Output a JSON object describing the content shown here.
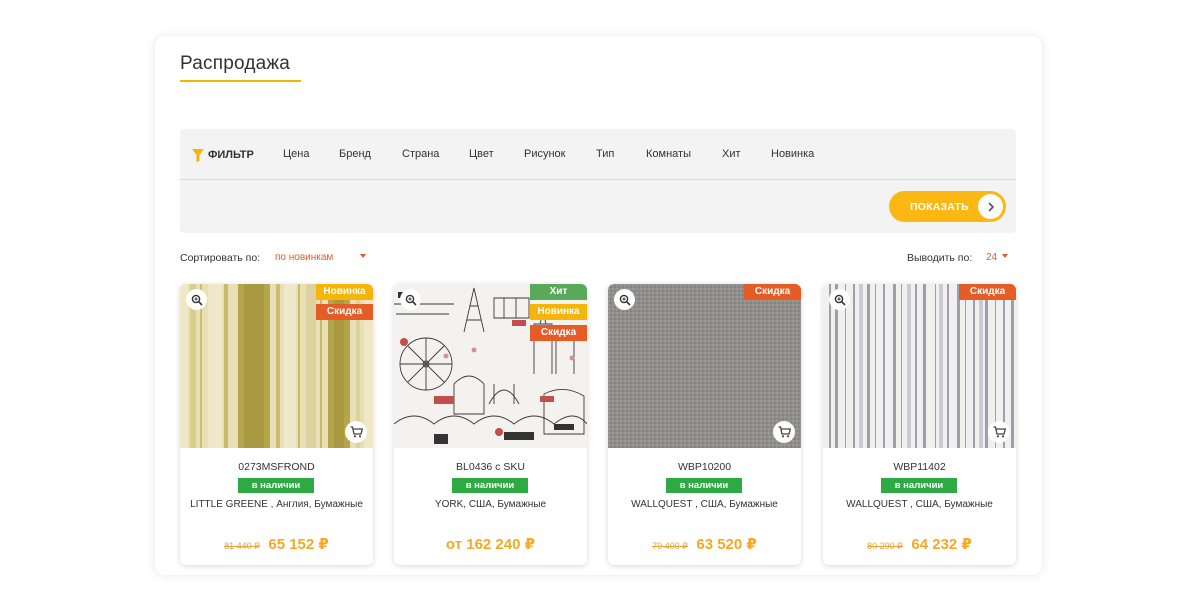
{
  "section": {
    "title": "Распродажа"
  },
  "filter": {
    "head_label": "ФИЛЬТР",
    "items": [
      "Цена",
      "Бренд",
      "Страна",
      "Цвет",
      "Рисунок",
      "Тип",
      "Комнаты",
      "Хит",
      "Новинка"
    ],
    "show_button": "ПОКАЗАТЬ"
  },
  "sort": {
    "label": "Сортировать по:",
    "value": "по новинкам"
  },
  "per_page": {
    "label": "Выводить по:",
    "value": "24"
  },
  "colors": {
    "accent": "#fbb813",
    "badge_new": "#f5b50b",
    "badge_sale": "#e65c26",
    "badge_hit": "#5aa85a",
    "in_stock": "#2eaa44",
    "price": "#f7a823"
  },
  "products": [
    {
      "badges": [
        "Новинка",
        "Скидка"
      ],
      "sku": "0273MSFROND",
      "stock": "в наличии",
      "desc": "LITTLE GREENE , Англия, Бумажные",
      "old_price": "81 440 ₽",
      "price": "65 152 ₽"
    },
    {
      "badges": [
        "Хит",
        "Новинка",
        "Скидка"
      ],
      "sku": "BL0436 c SKU",
      "stock": "в наличии",
      "desc": "YORK, США, Бумажные",
      "old_price": "",
      "price": "от 162 240 ₽"
    },
    {
      "badges": [
        "Скидка"
      ],
      "sku": "WBP10200",
      "stock": "в наличии",
      "desc": "WALLQUEST , США, Бумажные",
      "old_price": "79 400 ₽",
      "price": "63 520 ₽"
    },
    {
      "badges": [
        "Скидка"
      ],
      "sku": "WBP11402",
      "stock": "в наличии",
      "desc": "WALLQUEST , США, Бумажные",
      "old_price": "80 290 ₽",
      "price": "64 232 ₽"
    }
  ]
}
